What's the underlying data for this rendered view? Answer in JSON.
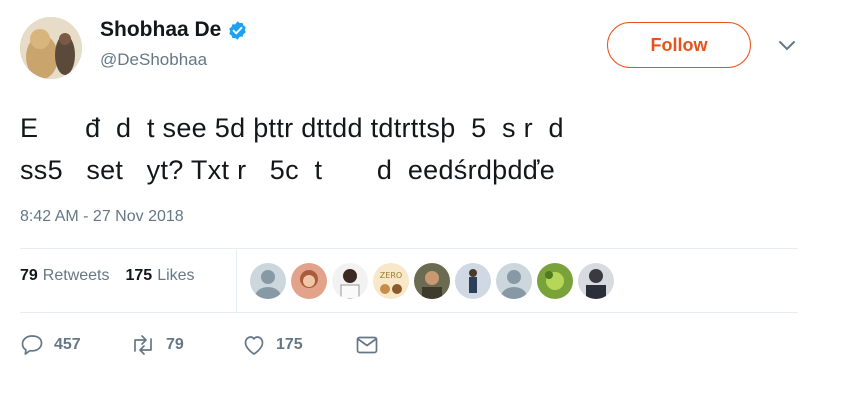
{
  "author": {
    "display_name": "Shobhaa De",
    "handle": "@DeShobhaa"
  },
  "follow_label": "Follow",
  "tweet": {
    "text": "E      đ  d  t see 5d þttr dttdd tdtrttsþ  5  s r  d\nss5   set   yt? Txt r   5c  t       d  eedśrdþdďe",
    "timestamp": "8:42 AM - 27 Nov 2018"
  },
  "stats": {
    "retweets_count": "79",
    "retweets_label": "Retweets",
    "likes_count": "175",
    "likes_label": "Likes"
  },
  "actions": {
    "reply_count": "457",
    "retweet_count": "79",
    "like_count": "175"
  },
  "colors": {
    "follow_accent": "#e8531d",
    "verified": "#1da1f2",
    "muted_text": "#657786"
  }
}
